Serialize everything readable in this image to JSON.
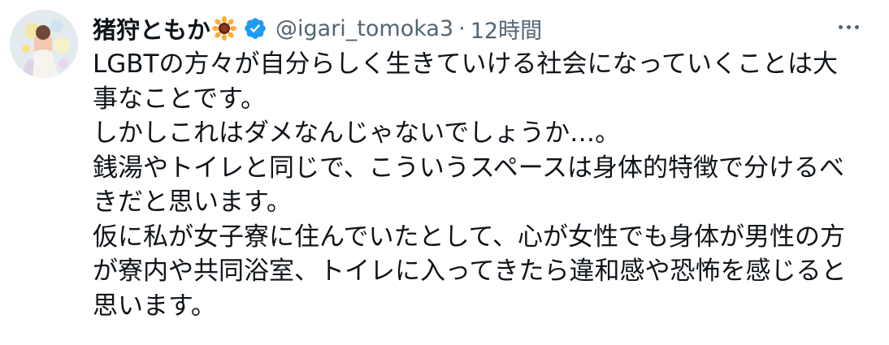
{
  "author": {
    "display_name": "猪狩ともか",
    "display_name_emoji": "sunflower-emoji",
    "verified": true,
    "verified_color": "#1d9bf0",
    "handle": "@igari_tomoka3",
    "separator": "·",
    "time": "12時間"
  },
  "menu": {
    "icon": "more-icon"
  },
  "tweet": {
    "lines": [
      "LGBTの方々が自分らしく生きていける社会になっていくことは大",
      "事なことです。",
      "しかしこれはダメなんじゃないでしょうか…。",
      "銭湯やトイレと同じで、こういうスペースは身体的特徴で分けるべ",
      "きだと思います。",
      "仮に私が女子寮に住んでいたとして、心が女性でも身体が男性の方",
      "が寮内や共同浴室、トイレに入ってきたら違和感や恐怖を感じると",
      "思います。"
    ]
  }
}
